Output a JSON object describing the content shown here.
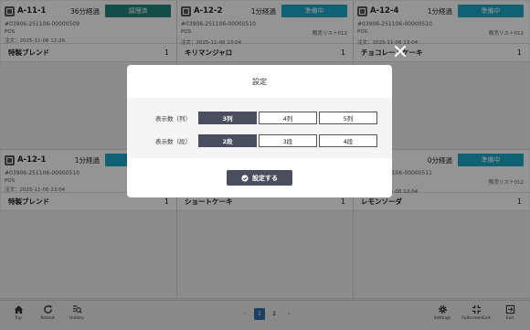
{
  "cards": [
    {
      "table": "A-11-1",
      "elapsed": "36分経過",
      "status": "調理済",
      "status_type": "done",
      "order_no": "#03906-251106-00000509",
      "source": "POS",
      "list": "",
      "ordered": "注文：2025-11-06 12:26",
      "items": [
        {
          "name": "特製ブレンド",
          "qty": "1"
        }
      ]
    },
    {
      "table": "A-12-2",
      "elapsed": "1分経過",
      "status": "準備中",
      "status_type": "prep",
      "order_no": "#03906-251106-00000510",
      "source": "POS",
      "list": "販売リスト012",
      "ordered": "注文：2025-11-06 13:04",
      "items": [
        {
          "name": "キリマンジャロ",
          "qty": "1"
        }
      ]
    },
    {
      "table": "A-12-4",
      "elapsed": "1分経過",
      "status": "準備中",
      "status_type": "prep",
      "order_no": "#03906-251106-00000510",
      "source": "POS",
      "list": "販売リスト012",
      "ordered": "注文：2025-11-06 13:04",
      "items": [
        {
          "name": "チョコレートケーキ",
          "qty": "1"
        }
      ]
    },
    {
      "table": "A-12-1",
      "elapsed": "1分経過",
      "status": "準備中",
      "status_type": "prep",
      "order_no": "#03906-251106-00000510",
      "source": "POS",
      "list": "",
      "ordered": "注文：2025-11-06 13:04",
      "items": [
        {
          "name": "特製ブレンド",
          "qty": "1"
        }
      ]
    },
    {
      "table": "",
      "elapsed": "",
      "status": "",
      "status_type": "prep",
      "order_no": "",
      "source": "",
      "list": "",
      "ordered": "",
      "items": [
        {
          "name": "ショートケーキ",
          "qty": "1"
        }
      ]
    },
    {
      "table": "",
      "elapsed": "0分経過",
      "status": "準備中",
      "status_type": "prep",
      "order_no": "#03906-251106-00000511",
      "source": "POS",
      "list": "販売リスト012",
      "ordered": "注文：2025-11-06 13:04",
      "items": [
        {
          "name": "レモンソーダ",
          "qty": "1"
        }
      ]
    }
  ],
  "modal": {
    "title": "設定",
    "columns_label": "表示数（列）",
    "column_options": [
      "3列",
      "4列",
      "5列"
    ],
    "column_selected": 0,
    "rows_label": "表示数（段）",
    "row_options": [
      "2段",
      "3段",
      "4段"
    ],
    "row_selected": 0,
    "submit_label": "設定する"
  },
  "footer": {
    "top": "Top",
    "reload": "Reload",
    "history": "History",
    "pages": [
      "1",
      "2"
    ],
    "current_page": "1",
    "settings": "Settings",
    "fullscreen": "FullscreenExit",
    "exit": "Exit"
  },
  "colors": {
    "status_done": "#20857c",
    "status_prep": "#1ea8c8",
    "active_segment": "#4a4e5f",
    "page_active": "#2f6ea8"
  }
}
